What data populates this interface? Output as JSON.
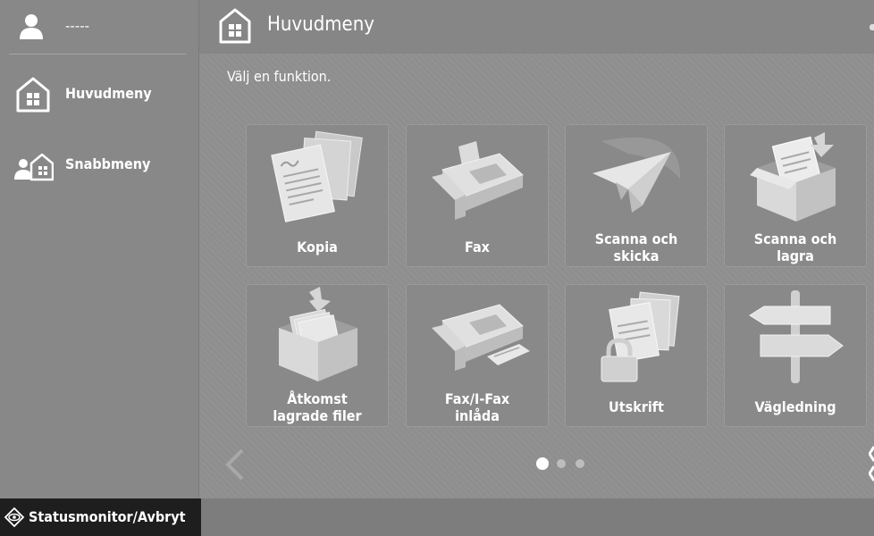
{
  "sidebar": {
    "user_name": "-----",
    "items": [
      {
        "label": "Huvudmeny",
        "icon": "home-icon"
      },
      {
        "label": "Snabbmeny",
        "icon": "quick-menu-icon"
      }
    ]
  },
  "header": {
    "title": "Huvudmeny",
    "icon": "home-icon"
  },
  "main": {
    "prompt": "Välj en funktion.",
    "tiles": [
      {
        "label": "Kopia",
        "icon": "copy-documents-icon"
      },
      {
        "label": "Fax",
        "icon": "fax-machine-icon"
      },
      {
        "label": "Scanna och\nskicka",
        "icon": "paper-plane-icon"
      },
      {
        "label": "Scanna och\nlagra",
        "icon": "document-box-icon"
      },
      {
        "label": "Åtkomst\nlagrade filer",
        "icon": "file-box-icon"
      },
      {
        "label": "Fax/I-Fax\ninlåda",
        "icon": "fax-inbox-icon"
      },
      {
        "label": "Utskrift",
        "icon": "locked-documents-icon"
      },
      {
        "label": "Vägledning",
        "icon": "signpost-icon"
      }
    ],
    "pagination": {
      "current": 1,
      "total": 3
    }
  },
  "footer": {
    "status_label": "Statusmonitor/Avbryt",
    "icon": "status-monitor-icon"
  }
}
